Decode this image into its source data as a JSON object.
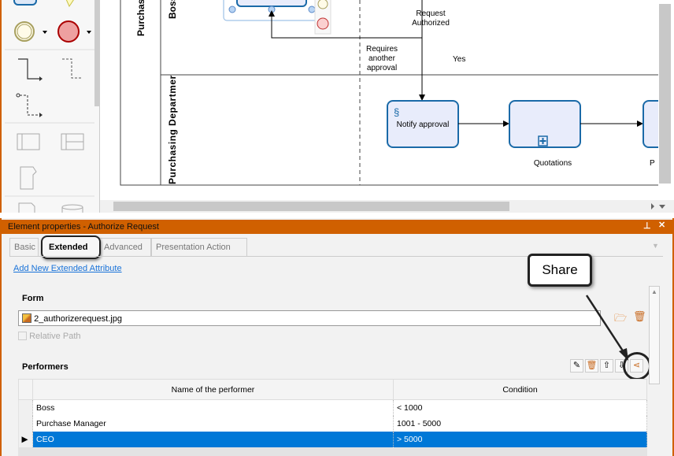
{
  "diagram": {
    "pool_label": "Purchas",
    "lanes": [
      "Boss",
      "Purchasing Departmer"
    ],
    "tasks": [
      "Notify approval",
      "Quotations",
      "P"
    ],
    "flow_labels": {
      "request_authorized": [
        "Request",
        "Authorized"
      ],
      "requires_approval": [
        "Requires",
        "another",
        "approval"
      ],
      "yes": "Yes"
    }
  },
  "panel": {
    "title": "Element properties - Authorize Request",
    "tabs": [
      "Basic",
      "Extended",
      "Advanced",
      "Presentation Action"
    ],
    "active_tab": "Extended",
    "add_link": "Add New Extended Attribute",
    "form_label": "Form",
    "form_value": "2_authorizerequest.jpg",
    "relative_path": "Relative Path",
    "performers_label": "Performers",
    "callout": "Share",
    "table": {
      "headers": [
        "Name of the performer",
        "Condition"
      ],
      "rows": [
        {
          "name": "Boss",
          "condition": "< 1000"
        },
        {
          "name": "Purchase Manager",
          "condition": "1001 - 5000"
        },
        {
          "name": "CEO",
          "condition": "> 5000"
        }
      ],
      "selected_row": 2
    }
  },
  "colors": {
    "accent": "#d06000",
    "selection": "#0078d7",
    "task_fill": "#e8ecfb",
    "task_stroke": "#1a6aa8"
  }
}
